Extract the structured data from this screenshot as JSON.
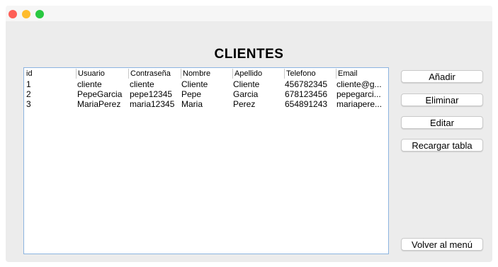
{
  "window": {
    "title": "CLIENTES"
  },
  "table": {
    "columns": [
      "id",
      "Usuario",
      "Contraseña",
      "Nombre",
      "Apellido",
      "Telefono",
      "Email"
    ],
    "rows": [
      [
        "1",
        "cliente",
        "cliente",
        "Cliente",
        "Cliente",
        "456782345",
        "cliente@g..."
      ],
      [
        "2",
        "PepeGarcia",
        "pepe12345",
        "Pepe",
        "Garcia",
        "678123456",
        "pepegarci..."
      ],
      [
        "3",
        "MariaPerez",
        "maria12345",
        "Maria",
        "Perez",
        "654891243",
        "mariapere..."
      ]
    ]
  },
  "buttons": {
    "add": "Añadir",
    "delete": "Eliminar",
    "edit": "Editar",
    "reload": "Recargar tabla",
    "back": "Volver al menú"
  },
  "colors": {
    "close": "#fe5f57",
    "minimize": "#febc2e",
    "zoom": "#28c840",
    "table_border": "#8cb4e0"
  }
}
